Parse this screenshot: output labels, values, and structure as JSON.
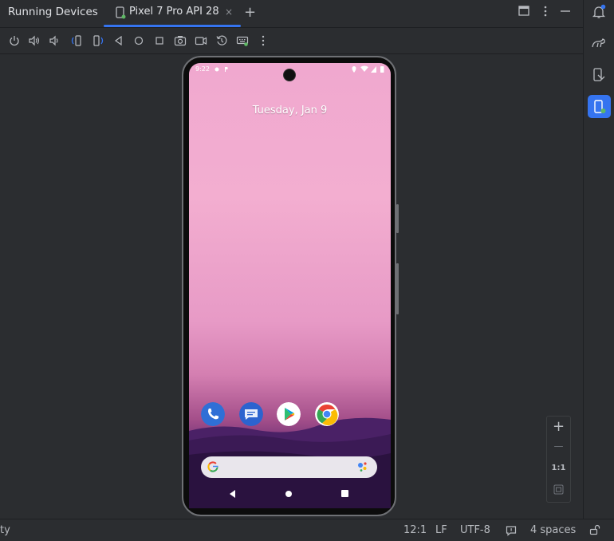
{
  "panel": {
    "title": "Running Devices"
  },
  "tabs": [
    {
      "label": "Pixel 7 Pro API 28",
      "close": "×"
    }
  ],
  "add_tab": "+",
  "toolbar": {
    "icons": [
      "power-icon",
      "volume-up-icon",
      "volume-down-icon",
      "rotate-left-icon",
      "rotate-right-icon",
      "back-icon",
      "home-icon",
      "overview-icon",
      "screenshot-icon",
      "screen-record-icon",
      "reset-icon",
      "keyboard-icon",
      "more-options-icon"
    ]
  },
  "phone": {
    "status_time": "9:22",
    "date": "Tuesday, Jan 9",
    "apps": [
      "phone-app-icon",
      "messages-app-icon",
      "play-store-app-icon",
      "chrome-app-icon"
    ]
  },
  "zoom": {
    "in": "+",
    "out": "—",
    "actual": "1:1"
  },
  "statusbar": {
    "left": "ty",
    "position": "12:1",
    "line_sep": "LF",
    "encoding": "UTF-8",
    "indent": "4 spaces"
  },
  "colors": {
    "accent": "#3574f0",
    "bg": "#2b2d30"
  }
}
